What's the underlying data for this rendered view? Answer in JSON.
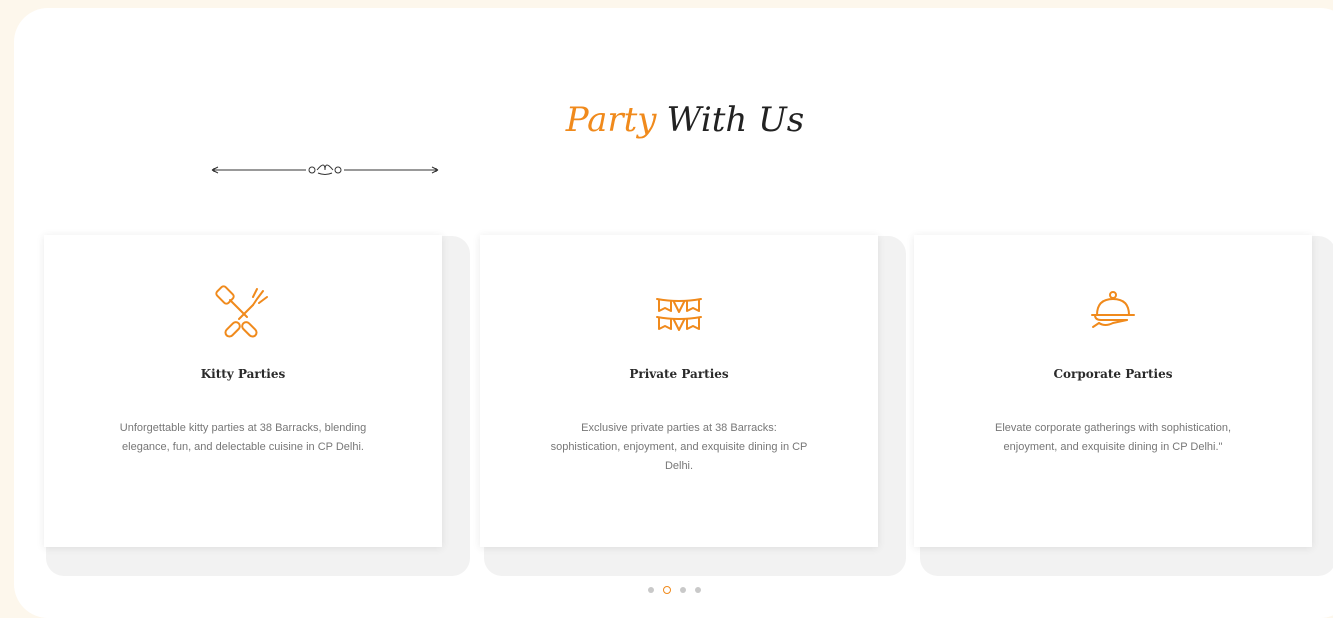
{
  "section": {
    "title_accent": "Party",
    "title_main": "With Us"
  },
  "cards": [
    {
      "icon": "utensils-icon",
      "title": "Kitty Parties",
      "description": "Unforgettable kitty parties at 38 Barracks, blending elegance, fun, and delectable cuisine in CP Delhi."
    },
    {
      "icon": "bunting-icon",
      "title": "Private Parties",
      "description": "Exclusive private parties at 38 Barracks: sophistication, enjoyment, and exquisite dining in CP Delhi."
    },
    {
      "icon": "serving-dome-icon",
      "title": "Corporate Parties",
      "description": "Elevate corporate gatherings with sophistication, enjoyment, and exquisite dining in CP Delhi.\""
    }
  ],
  "carousel": {
    "total_pages": 4,
    "active_page": 2
  },
  "colors": {
    "accent": "#f08a1c",
    "page_background": "#fdf7ec",
    "text_dark": "#2a2a2a",
    "text_muted": "#777777"
  }
}
